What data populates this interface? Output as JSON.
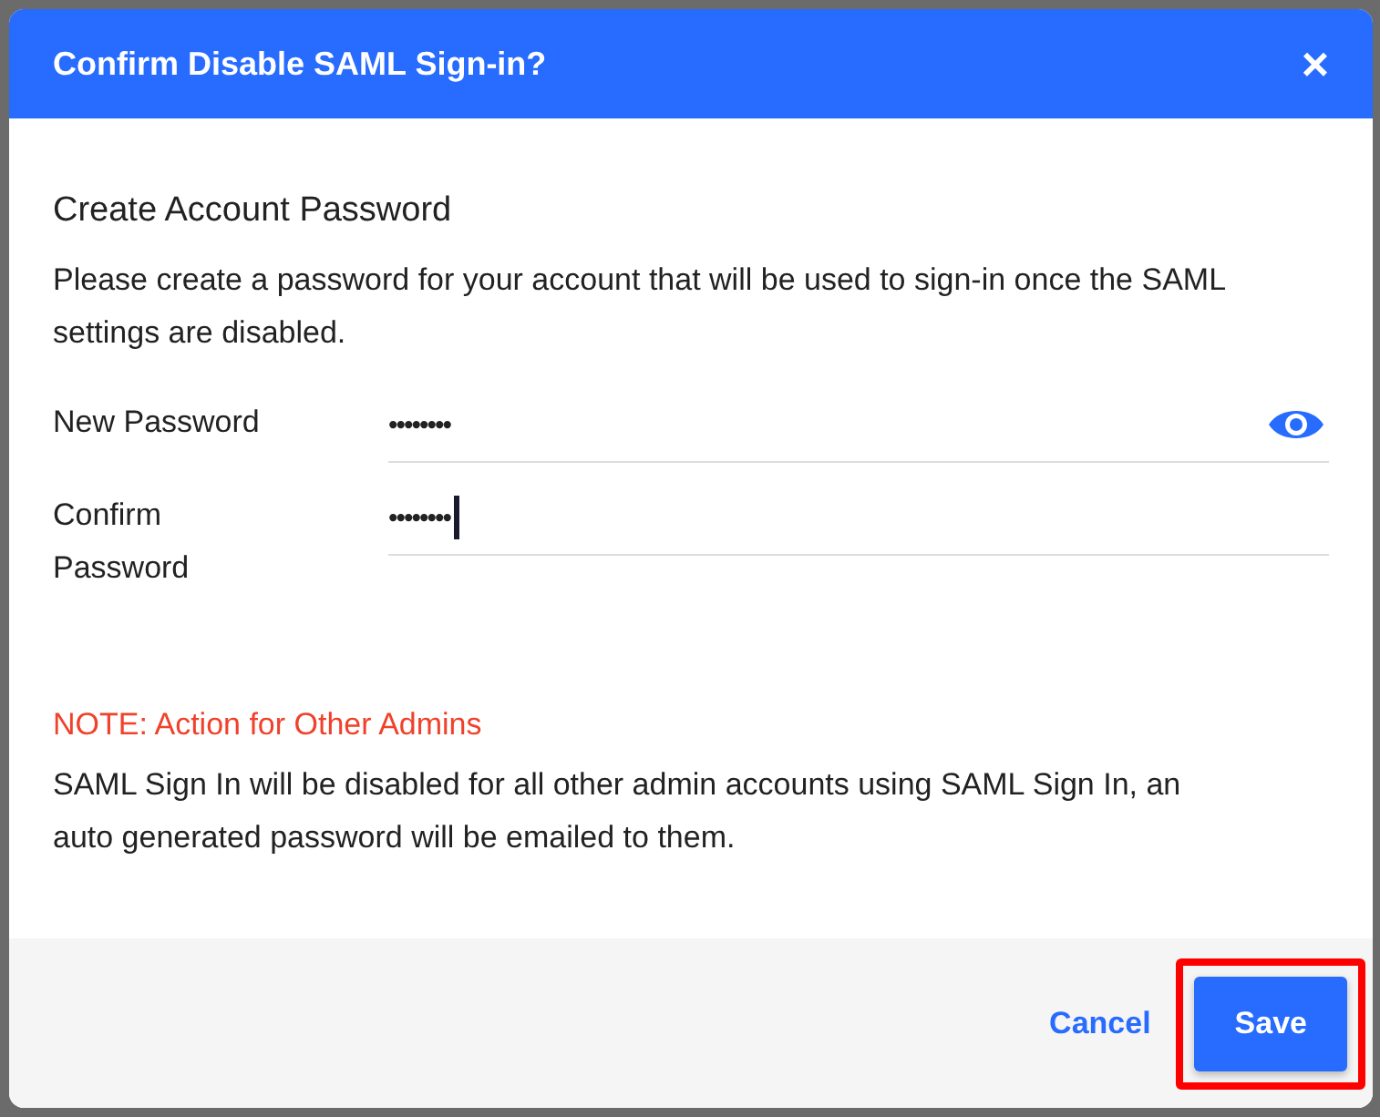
{
  "dialog": {
    "title": "Confirm Disable SAML Sign-in?",
    "close": "×"
  },
  "section_title": "Create Account Password",
  "description": "Please create a password for your account that will be used to sign-in once the SAML settings are disabled.",
  "fields": [
    {
      "label": "New Password",
      "value": "••••••••",
      "focused": false,
      "reveal_icon": true
    },
    {
      "label": "Confirm Password",
      "value": "••••••••",
      "focused": true,
      "reveal_icon": false
    }
  ],
  "note": {
    "title": "NOTE: Action for Other Admins",
    "text": "SAML Sign In will be disabled for all other admin accounts using SAML Sign In, an auto generated password will be emailed to them."
  },
  "buttons": [
    {
      "kind": "link",
      "label": "Cancel",
      "highlighted": false
    },
    {
      "kind": "primary",
      "label": "Save",
      "highlighted": true
    }
  ]
}
